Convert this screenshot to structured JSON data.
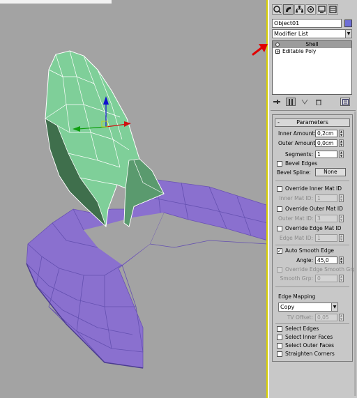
{
  "viewport": {
    "background": "#a3a3a3",
    "border_color": "#d8d000",
    "annotation_arrow_color": "#e00000"
  },
  "command_panel": {
    "tabs": [
      {
        "icon": "create-icon"
      },
      {
        "icon": "modify-icon"
      },
      {
        "icon": "hierarchy-icon"
      },
      {
        "icon": "motion-icon"
      },
      {
        "icon": "display-icon"
      },
      {
        "icon": "utilities-icon"
      }
    ],
    "object_name": "Object01",
    "object_color": "#6f6fd8",
    "modifier_list_label": "Modifier List",
    "stack": {
      "items": [
        {
          "label": "Shell",
          "selected": true
        },
        {
          "label": "Editable Poly",
          "selected": false
        }
      ]
    },
    "stack_tools": [
      "pin-stack-icon",
      "show-end-result-icon",
      "make-unique-icon",
      "remove-modifier-icon",
      "configure-modifier-sets-icon"
    ]
  },
  "parameters": {
    "title": "Parameters",
    "inner_amount": {
      "label": "Inner Amount:",
      "value": "0,2cm"
    },
    "outer_amount": {
      "label": "Outer Amount:",
      "value": "0,0cm"
    },
    "segments": {
      "label": "Segments:",
      "value": "1"
    },
    "bevel_edges": {
      "label": "Bevel Edges",
      "checked": false
    },
    "bevel_spline": {
      "label": "Bevel Spline:",
      "button": "None"
    },
    "override_inner_mat": {
      "label": "Override Inner Mat ID",
      "checked": false
    },
    "inner_mat_id": {
      "label": "Inner Mat ID:",
      "value": "1"
    },
    "override_outer_mat": {
      "label": "Override Outer Mat ID",
      "checked": false
    },
    "outer_mat_id": {
      "label": "Outer Mat ID:",
      "value": "3"
    },
    "override_edge_mat": {
      "label": "Override Edge Mat ID",
      "checked": false
    },
    "edge_mat_id": {
      "label": "Edge Mat ID:",
      "value": "1"
    },
    "auto_smooth_edge": {
      "label": "Auto Smooth Edge",
      "checked": true,
      "mark": "✓"
    },
    "angle": {
      "label": "Angle:",
      "value": "45,0"
    },
    "override_edge_smooth": {
      "label": "Override Edge Smooth Grp",
      "checked": false
    },
    "smooth_grp": {
      "label": "Smooth Grp:",
      "value": "0"
    },
    "edge_mapping": {
      "label": "Edge Mapping",
      "value": "Copy"
    },
    "tv_offset": {
      "label": "TV Offset:",
      "value": "0,05"
    },
    "select_edges": {
      "label": "Select Edges",
      "checked": false
    },
    "select_inner_faces": {
      "label": "Select Inner Faces",
      "checked": false
    },
    "select_outer_faces": {
      "label": "Select Outer Faces",
      "checked": false
    },
    "straighten_corners": {
      "label": "Straighten Corners",
      "checked": false
    }
  }
}
